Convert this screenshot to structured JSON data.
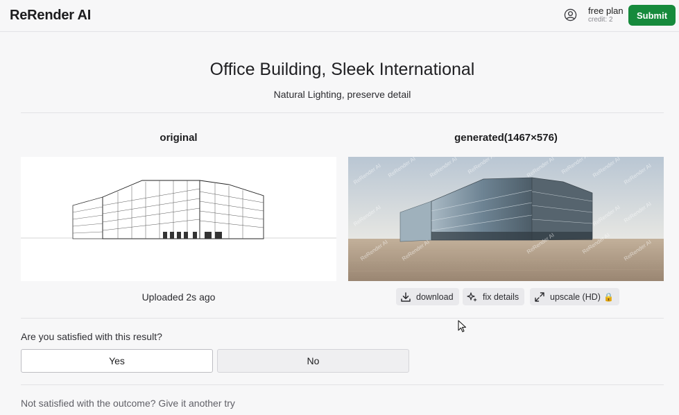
{
  "app": {
    "brand": "ReRender AI",
    "plan_name": "free plan",
    "plan_credit": "credit: 2",
    "submit_label": "Submit",
    "accent_color": "#168a3c"
  },
  "header_icons": {
    "user": "user-circle-icon"
  },
  "project": {
    "title": "Office Building, Sleek International",
    "subtitle": "Natural Lighting, preserve detail"
  },
  "original": {
    "label": "original",
    "uploaded": "Uploaded 2s ago"
  },
  "generated": {
    "label": "generated(1467×576)",
    "watermark": "ReRender AI"
  },
  "actions": {
    "download_label": "download",
    "download_icon": "download-icon",
    "fix_label": "fix details",
    "fix_icon": "sparkles-icon",
    "upscale_label": "upscale (HD)",
    "upscale_icon": "expand-icon",
    "lock_glyph": "🔒"
  },
  "feedback": {
    "question": "Are you satisfied with this result?",
    "yes_label": "Yes",
    "no_label": "No"
  },
  "retry": {
    "text": "Not satisfied with the outcome? Give it another try"
  }
}
